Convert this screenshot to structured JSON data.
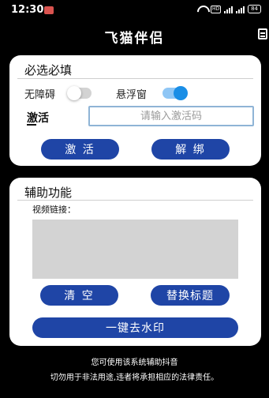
{
  "status_bar": {
    "time": "12:30",
    "hd_label": "HD",
    "battery": "84"
  },
  "header": {
    "title": "飞猫伴侣"
  },
  "required_section": {
    "heading": "必选必填",
    "accessibility_label": "无障碍",
    "accessibility_enabled": false,
    "floating_window_label": "悬浮窗",
    "floating_window_enabled": true,
    "activation_label": "激活",
    "activation_input": {
      "value": "",
      "placeholder": "请输入激活码"
    },
    "activate_button": "激 活",
    "unbind_button": "解 绑"
  },
  "assist_section": {
    "heading": "辅助功能",
    "video_link_label": "视频链接：",
    "clear_button": "清 空",
    "replace_title_button": "替换标题",
    "remove_watermark_button": "一键去水印"
  },
  "footer": {
    "line1": "您可使用该系统辅助抖音",
    "line2": "切勿用于非法用途,违者将承担相应的法律责任。"
  },
  "colors": {
    "button_blue": "#1f45a6",
    "switch_on": "#1a8ee6",
    "input_border": "#8fb4d6",
    "video_box": "#d3d3d3"
  }
}
